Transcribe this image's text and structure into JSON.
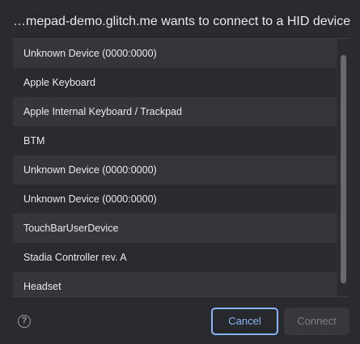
{
  "dialog": {
    "title": "…mepad-demo.glitch.me wants to connect to a HID device"
  },
  "devices": [
    "Unknown Device (0000:0000)",
    "Apple Keyboard",
    "Apple Internal Keyboard / Trackpad",
    "BTM",
    "Unknown Device (0000:0000)",
    "Unknown Device (0000:0000)",
    "TouchBarUserDevice",
    "Stadia Controller rev. A",
    "Headset"
  ],
  "footer": {
    "help_icon": "help-circle-icon",
    "help_glyph": "?",
    "cancel_label": "Cancel",
    "connect_label": "Connect"
  },
  "colors": {
    "accent": "#8ab4f8",
    "background": "#292a2d",
    "row_alt": "#35363a"
  }
}
